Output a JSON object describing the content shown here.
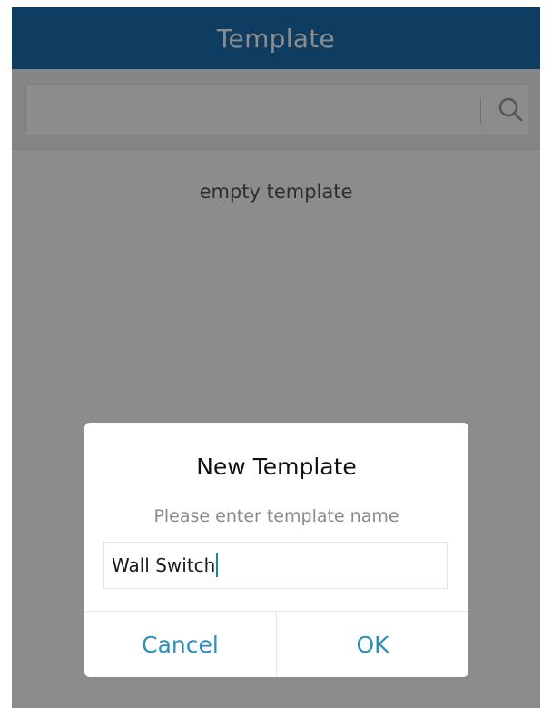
{
  "header": {
    "title": "Template"
  },
  "search": {
    "placeholder": "",
    "value": "",
    "icon": "search-icon"
  },
  "list": {
    "empty_text": "empty template"
  },
  "dialog": {
    "title": "New Template",
    "message": "Please enter template name",
    "input_value": "Wall Switch",
    "cancel_label": "Cancel",
    "ok_label": "OK"
  },
  "colors": {
    "header_bg": "#1d6fb1",
    "button_text": "#2b8fbe",
    "overlay": "rgba(0,0,0,0.45)"
  }
}
